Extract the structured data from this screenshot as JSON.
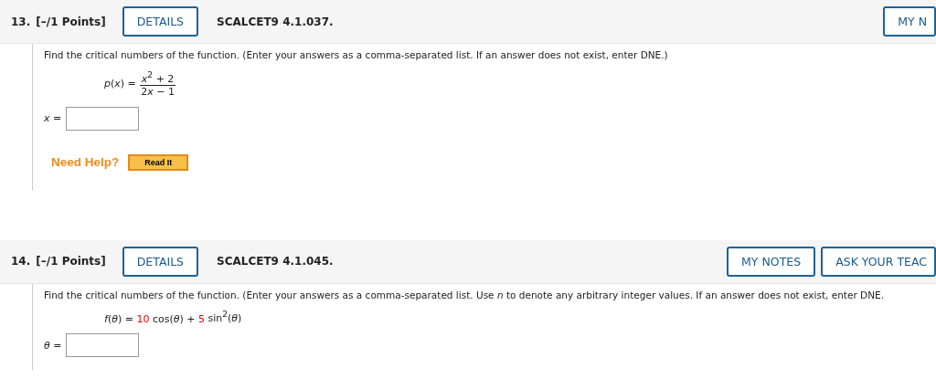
{
  "questions": [
    {
      "number": "13.",
      "points": "[–/1 Points]",
      "details_button": "DETAILS",
      "code": "SCALCET9 4.1.037.",
      "header_buttons": [
        "MY N"
      ],
      "instruction": "Find the critical numbers of the function. (Enter your answers as a comma-separated list. If an answer does not exist, enter DNE.)",
      "formula": {
        "kind": "fraction",
        "lhs": "*p*(*x*) =",
        "numerator": "*x*$^{2}$ + 2",
        "denominator": [
          "2",
          "*x* − 1"
        ]
      },
      "answer_label": "*x* =",
      "need_help": {
        "label": "Need Help?",
        "buttons": [
          "Read It"
        ]
      }
    },
    {
      "number": "14.",
      "points": "[–/1 Points]",
      "details_button": "DETAILS",
      "code": "SCALCET9 4.1.045.",
      "header_buttons": [
        "MY NOTES",
        "ASK YOUR TEAC"
      ],
      "instruction": "Find the critical numbers of the function. (Enter your answers as a comma-separated list. Use *n* to denote any arbitrary integer values. If an answer does not exist, enter DNE.",
      "formula": {
        "kind": "inline",
        "terms": [
          {
            "text": "*f*(*θ*) = ",
            "kind": "plain"
          },
          {
            "text": "10",
            "kind": "given"
          },
          {
            "text": " cos(*θ*) + ",
            "kind": "plain"
          },
          {
            "text": "5",
            "kind": "given"
          },
          {
            "text": " sin$^{2}$(*θ*)",
            "kind": "plain"
          }
        ]
      },
      "answer_label": "*θ* ="
    }
  ]
}
